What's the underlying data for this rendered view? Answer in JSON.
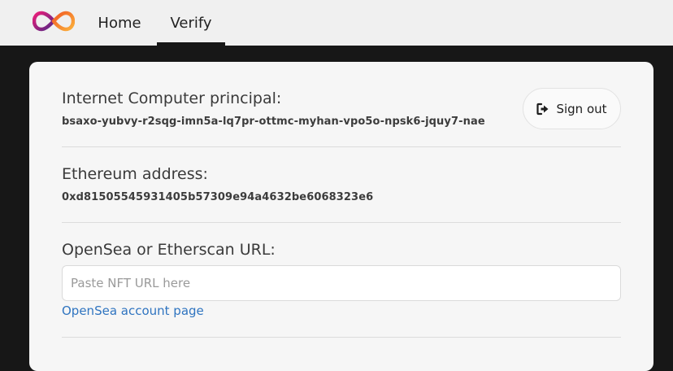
{
  "nav": {
    "home_label": "Home",
    "verify_label": "Verify"
  },
  "principal": {
    "label": "Internet Computer principal:",
    "value": "bsaxo-yubvy-r2sqg-imn5a-lq7pr-ottmc-myhan-vpo5o-npsk6-jquy7-nae"
  },
  "signout": {
    "label": "Sign out",
    "icon": "sign-out-icon"
  },
  "ethereum": {
    "label": "Ethereum address:",
    "value": "0xd81505545931405b57309e94a4632be6068323e6"
  },
  "nft_url": {
    "label": "OpenSea or Etherscan URL:",
    "placeholder": "Paste NFT URL here",
    "value": ""
  },
  "opensea_link": {
    "label": "OpenSea account page"
  },
  "colors": {
    "background": "#171717",
    "topbar": "#f0f0f0",
    "card": "#f6f6f6",
    "link": "#2f74c0"
  }
}
